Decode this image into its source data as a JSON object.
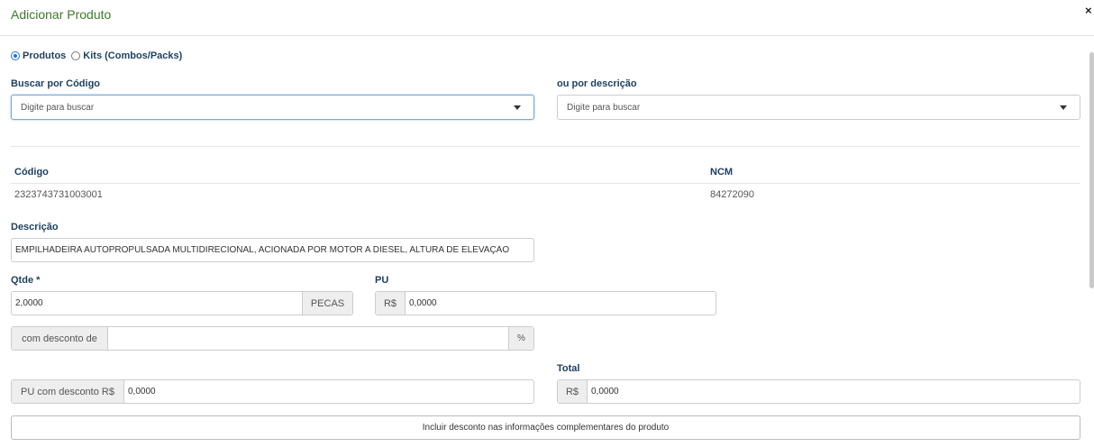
{
  "modal": {
    "title": "Adicionar Produto"
  },
  "icons": {
    "close": "close-icon",
    "caret": "caret-down-icon"
  },
  "type_selector": {
    "options": [
      {
        "label": "Produtos",
        "selected": true
      },
      {
        "label": "Kits (Combos/Packs)",
        "selected": false
      }
    ]
  },
  "search": {
    "by_code_label": "Buscar por Código",
    "by_code_placeholder": "Digite para buscar",
    "by_description_label": "ou por descrição",
    "by_description_placeholder": "Digite para buscar"
  },
  "product": {
    "code_label": "Código",
    "code_value": "2323743731003001",
    "ncm_label": "NCM",
    "ncm_value": "84272090",
    "description_label": "Descrição",
    "description_value": "EMPILHADEIRA AUTOPROPULSADA MULTIDIRECIONAL, ACIONADA POR MOTOR A DIESEL, ALTURA DE ELEVAÇÃO"
  },
  "quantity": {
    "label": "Qtde *",
    "value": "2,0000",
    "unit": "PECAS"
  },
  "unit_price": {
    "label": "PU",
    "currency": "R$",
    "value": "0,0000"
  },
  "discount": {
    "prefix": "com desconto de",
    "value": "",
    "suffix": "%"
  },
  "discounted_price": {
    "prefix": "PU com desconto R$",
    "value": "0,0000"
  },
  "total": {
    "label": "Total",
    "currency": "R$",
    "value": "0,0000"
  },
  "actions": {
    "include_discount_label": "Incluir desconto nas informações complementares do produto"
  }
}
